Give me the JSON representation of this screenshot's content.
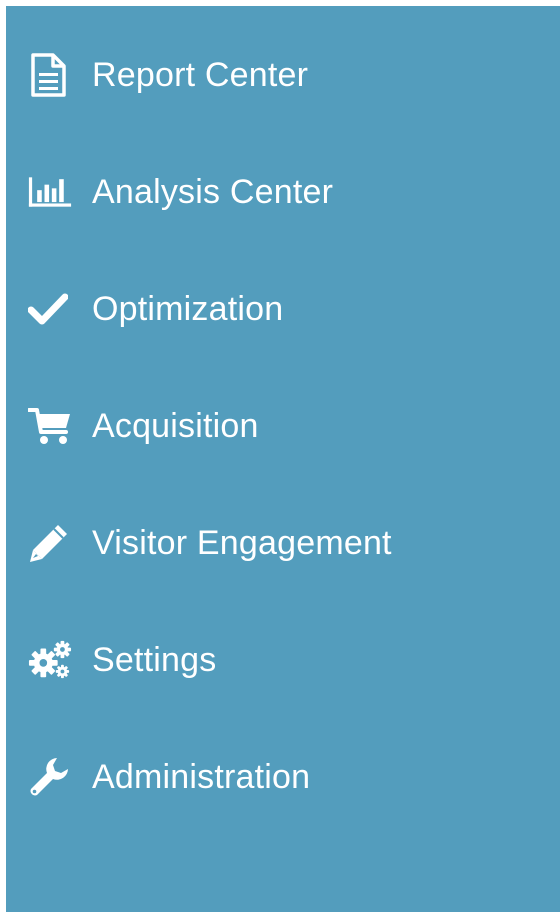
{
  "sidebar": {
    "background_color": "#539dbd",
    "text_color": "#ffffff",
    "items": [
      {
        "label": "Report Center",
        "icon": "document-icon"
      },
      {
        "label": "Analysis Center",
        "icon": "bar-chart-icon"
      },
      {
        "label": "Optimization",
        "icon": "check-icon"
      },
      {
        "label": "Acquisition",
        "icon": "shopping-cart-icon"
      },
      {
        "label": "Visitor Engagement",
        "icon": "pencil-icon"
      },
      {
        "label": "Settings",
        "icon": "gears-icon"
      },
      {
        "label": "Administration",
        "icon": "wrench-icon"
      }
    ]
  }
}
